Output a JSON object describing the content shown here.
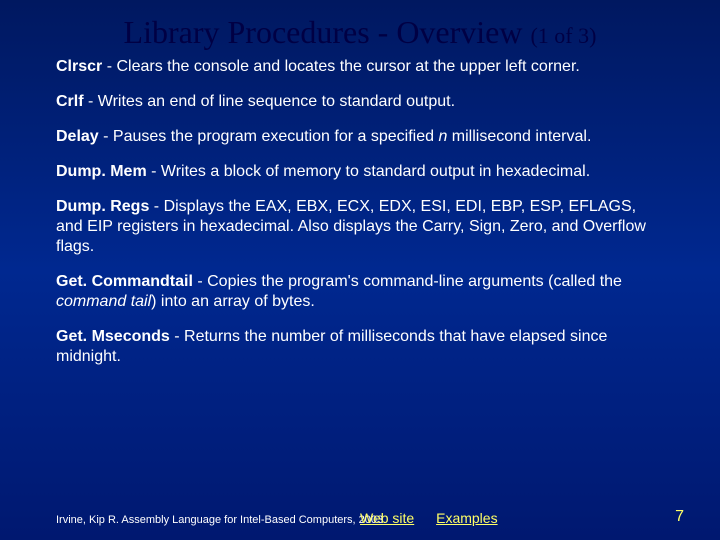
{
  "title": {
    "main": "Library Procedures - Overview",
    "sub": "(1 of 3)"
  },
  "entries": [
    {
      "name": "Clrscr",
      "sep": " - ",
      "desc_before": "Clears the console and locates the cursor at the upper left corner.",
      "italic": "",
      "desc_after": ""
    },
    {
      "name": "Crlf",
      "sep": " - ",
      "desc_before": "Writes an end of line sequence to standard output.",
      "italic": "",
      "desc_after": ""
    },
    {
      "name": "Delay",
      "sep": " - ",
      "desc_before": "Pauses the program execution for a specified ",
      "italic": "n",
      "desc_after": " millisecond interval."
    },
    {
      "name": "Dump. Mem",
      "sep": " - ",
      "desc_before": "Writes a block of memory to standard output in hexadecimal.",
      "italic": "",
      "desc_after": ""
    },
    {
      "name": "Dump. Regs",
      "sep": " - ",
      "desc_before": "Displays the EAX, EBX, ECX, EDX, ESI, EDI, EBP, ESP, EFLAGS, and EIP registers in hexadecimal. Also displays the Carry, Sign, Zero, and Overflow flags.",
      "italic": "",
      "desc_after": ""
    },
    {
      "name": "Get. Commandtail",
      "sep": " - ",
      "desc_before": "Copies the program's command-line arguments (called the ",
      "italic": "command tail",
      "desc_after": ") into an array of bytes."
    },
    {
      "name": "Get. Mseconds",
      "sep": " - ",
      "desc_before": "Returns the number of milliseconds that have elapsed since midnight.",
      "italic": "",
      "desc_after": ""
    }
  ],
  "footer": {
    "citation": "Irvine, Kip R. Assembly Language for Intel-Based Computers, 2003.",
    "link1": "Web site",
    "link2": "Examples",
    "page": "7"
  }
}
